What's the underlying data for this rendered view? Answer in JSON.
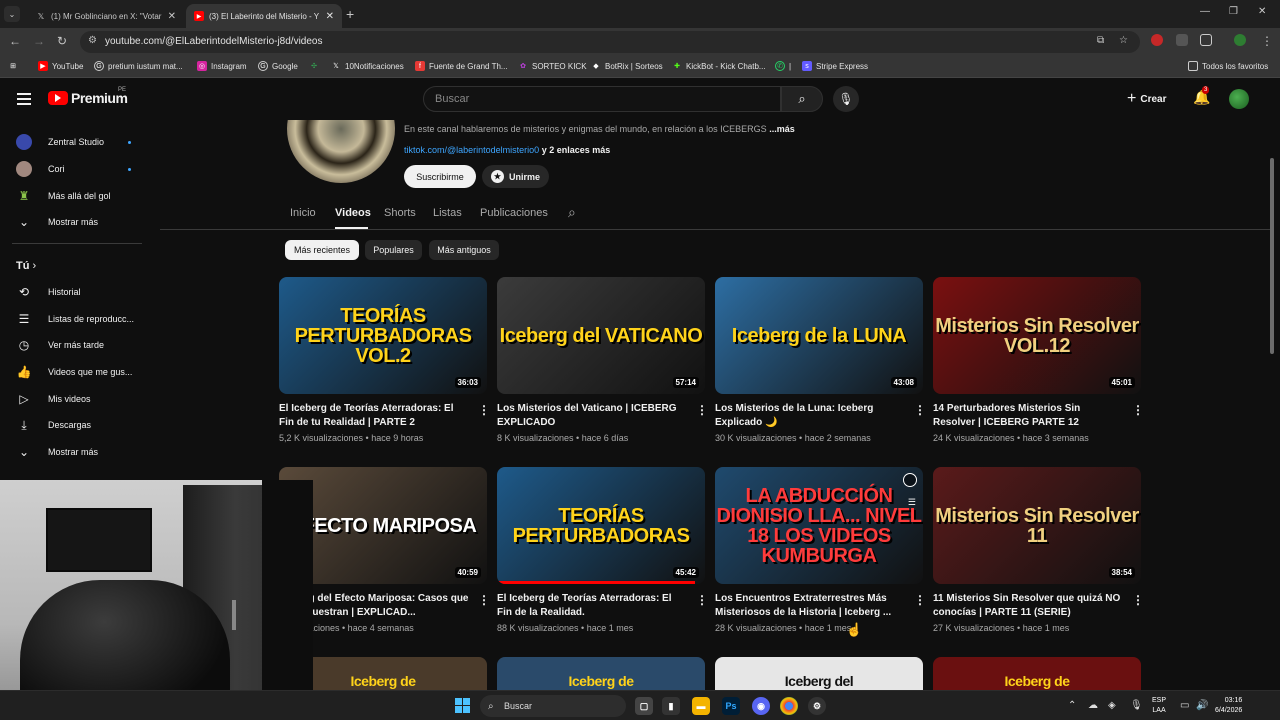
{
  "browser": {
    "tabs": [
      {
        "title": "(1) Mr Goblinciano en X: \"Votar",
        "icon": "x-logo-icon",
        "active": false
      },
      {
        "title": "(3) El Laberinto del Misterio - Y",
        "icon": "youtube-icon",
        "active": true
      }
    ],
    "url": "youtube.com/@ElLaberintodelMisterio-j8d/videos",
    "bookmarks": [
      {
        "label": "YouTube",
        "icon": "youtube-icon",
        "color": "#ff0000"
      },
      {
        "label": "pretium iustum mat...",
        "icon": "google-icon",
        "color": "#e3e3e3"
      },
      {
        "label": "Instagram",
        "icon": "instagram-icon",
        "color": "#d6249f"
      },
      {
        "label": "Google",
        "icon": "google-icon",
        "color": "#e3e3e3"
      },
      {
        "label": "",
        "icon": "pinwheel-icon",
        "color": "#34a853"
      },
      {
        "label": "10Notificaciones",
        "icon": "x-logo-icon",
        "color": "#000000"
      },
      {
        "label": "Fuente de Grand Th...",
        "icon": "font-icon",
        "color": "#e53935"
      },
      {
        "label": "SORTEO KICK",
        "icon": "sorteo-icon",
        "color": "#9c27b0"
      },
      {
        "label": "BotRix | Sorteos",
        "icon": "botrix-icon",
        "color": "#ffffff"
      },
      {
        "label": "KickBot - Kick Chatb...",
        "icon": "kickbot-icon",
        "color": "#53fc18"
      },
      {
        "label": "|",
        "icon": "whatsapp-icon",
        "color": "#25d366"
      },
      {
        "label": "Stripe Express",
        "icon": "stripe-icon",
        "color": "#635bff"
      }
    ],
    "all_bookmarks": "Todos los favoritos"
  },
  "youtube": {
    "logo": "Premium",
    "country": "PE",
    "search_placeholder": "Buscar",
    "create": "Crear",
    "notifications": "3"
  },
  "sidebar": {
    "subscriptions": [
      {
        "label": "Zentral Studio",
        "dot": true
      },
      {
        "label": "Cori",
        "dot": true
      },
      {
        "label": "Más allá del gol",
        "dot": false
      }
    ],
    "show_more_1": "Mostrar más",
    "you_title": "Tú",
    "you_items": [
      {
        "label": "Historial",
        "icon": "history-icon"
      },
      {
        "label": "Listas de reproducc...",
        "icon": "playlists-icon"
      },
      {
        "label": "Ver más tarde",
        "icon": "watch-later-icon"
      },
      {
        "label": "Videos que me gus...",
        "icon": "thumbs-up-icon"
      },
      {
        "label": "Mis videos",
        "icon": "my-videos-icon"
      },
      {
        "label": "Descargas",
        "icon": "download-icon"
      }
    ],
    "show_more_2": "Mostrar más"
  },
  "channel": {
    "description": "En este canal hablaremos de misterios y enigmas del mundo, en relación a los ICEBERGS",
    "more": "...más",
    "link": "tiktok.com/@laberintodelmisterio0",
    "more_links": " y 2 enlaces más",
    "subscribe": "Suscribirme",
    "join": "Unirme",
    "tabs": [
      "Inicio",
      "Videos",
      "Shorts",
      "Listas",
      "Publicaciones"
    ],
    "active_tab": "Videos",
    "chips": [
      "Más recientes",
      "Populares",
      "Más antiguos"
    ]
  },
  "videos": [
    {
      "title": "El Iceberg de Teorías Aterradoras: El Fin de tu Realidad | PARTE 2",
      "meta": "5,2 K visualizaciones • hace 9 horas",
      "duration": "36:03",
      "thumb_text": "TEORÍAS PERTURBADORAS VOL.2",
      "thumb_bg": "#1e5a8a",
      "thumb_fg": "#ffd31a",
      "progress": 0
    },
    {
      "title": "Los Misterios del Vaticano | ICEBERG EXPLICADO",
      "meta": "8 K visualizaciones • hace 6 días",
      "duration": "57:14",
      "thumb_text": "Iceberg del VATICANO",
      "thumb_bg": "#3b3b3b",
      "thumb_fg": "#ffd31a",
      "progress": 0
    },
    {
      "title": "Los Misterios de la Luna: Iceberg Explicado 🌙",
      "meta": "30 K visualizaciones • hace 2 semanas",
      "duration": "43:08",
      "thumb_text": "Iceberg de la LUNA",
      "thumb_bg": "#2d6ea3",
      "thumb_fg": "#ffd31a",
      "progress": 0
    },
    {
      "title": "14 Perturbadores Misterios Sin Resolver | ICEBERG PARTE 12",
      "meta": "24 K visualizaciones • hace 3 semanas",
      "duration": "45:01",
      "thumb_text": "Misterios Sin Resolver VOL.12",
      "thumb_bg": "#7a1010",
      "thumb_fg": "#f0d080",
      "progress": 0
    },
    {
      "title": "Iceberg del Efecto Mariposa: Casos que lo Demuestran | EXPLICAD...",
      "meta": "visualizaciones • hace 4 semanas",
      "duration": "40:59",
      "thumb_text": "EFECTO MARIPOSA",
      "thumb_bg": "#5a4a3a",
      "thumb_fg": "#ffffff",
      "progress": 0
    },
    {
      "title": "El Iceberg de Teorías Aterradoras: El Fin de la Realidad.",
      "meta": "88 K visualizaciones • hace 1 mes",
      "duration": "45:42",
      "thumb_text": "TEORÍAS PERTURBADORAS",
      "thumb_bg": "#1e5a8a",
      "thumb_fg": "#ffd31a",
      "progress": 0.95
    },
    {
      "title": "Los Encuentros Extraterrestres Más Misteriosos de la Historia | Iceberg ...",
      "meta": "28 K visualizaciones • hace 1 mes",
      "duration": "",
      "thumb_text": "LA ABDUCCIÓN DIONISIO LLA... NIVEL 18 LOS VIDEOS KUMBURGA",
      "thumb_bg": "#1f4a6e",
      "thumb_fg": "#ff3b3b",
      "progress": 0
    },
    {
      "title": "11 Misterios Sin Resolver que quizá NO conocías | PARTE 11 (SERIE)",
      "meta": "27 K visualizaciones • hace 1 mes",
      "duration": "38:54",
      "thumb_text": "Misterios Sin Resolver 11",
      "thumb_bg": "#5a1a1a",
      "thumb_fg": "#f0d080",
      "progress": 0
    }
  ],
  "more_thumbs": [
    {
      "thumb_text": "Iceberg de",
      "thumb_bg": "#4a3a2a",
      "thumb_fg": "#ffd31a"
    },
    {
      "thumb_text": "Iceberg de",
      "thumb_bg": "#2a4a6a",
      "thumb_fg": "#ffd31a"
    },
    {
      "thumb_text": "Iceberg del",
      "thumb_bg": "#e6e6e6",
      "thumb_fg": "#111111"
    },
    {
      "thumb_text": "Iceberg de",
      "thumb_bg": "#6a1010",
      "thumb_fg": "#ffd31a"
    }
  ],
  "taskbar": {
    "search": "Buscar",
    "lang": "ESP",
    "lang2": "LAA",
    "time": "03:16",
    "date": "6/4/2026"
  }
}
